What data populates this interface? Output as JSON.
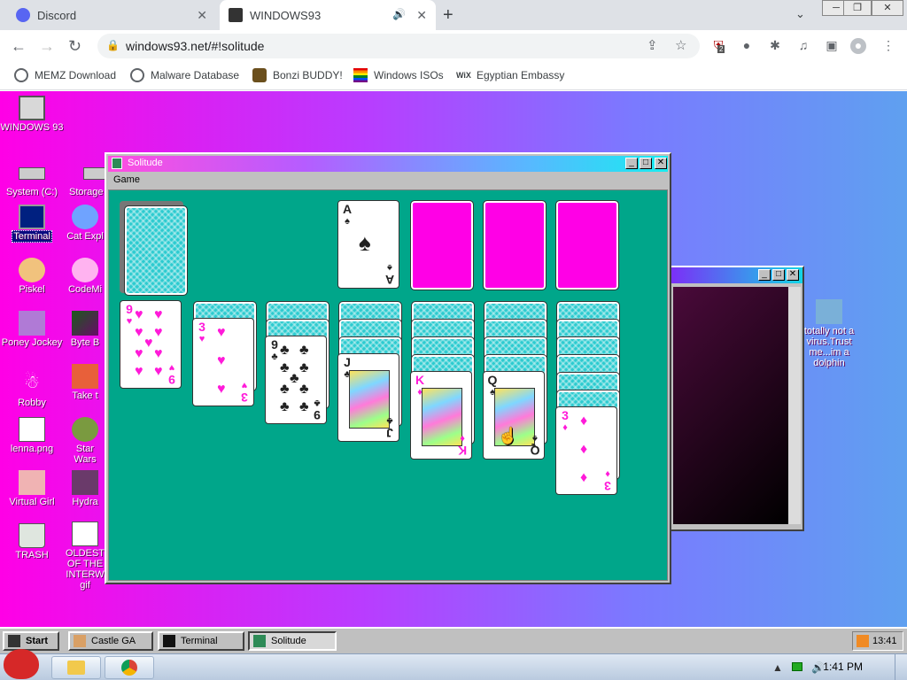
{
  "browser": {
    "tabs": [
      {
        "title": "Discord",
        "active": false
      },
      {
        "title": "WINDOWS93",
        "active": true
      }
    ],
    "url": "windows93.net/#!solitude",
    "window_controls": {
      "minimize": "─",
      "maximize": "❐",
      "close": "✕"
    },
    "bookmarks": [
      {
        "label": "MEMZ Download"
      },
      {
        "label": "Malware Database"
      },
      {
        "label": "Bonzi BUDDY!"
      },
      {
        "label": "Windows ISOs"
      },
      {
        "label": "Egyptian Embassy"
      }
    ],
    "extension_badge": "2"
  },
  "desktop": {
    "icons": [
      {
        "label": "WINDOWS 93"
      },
      {
        "label": "System (C:)"
      },
      {
        "label": "Storage"
      },
      {
        "label": "Terminal"
      },
      {
        "label": "Cat Expl"
      },
      {
        "label": "Piskel"
      },
      {
        "label": "CodeMi"
      },
      {
        "label": "Poney Jockey"
      },
      {
        "label": "Byte B"
      },
      {
        "label": "Robby"
      },
      {
        "label": "Take t"
      },
      {
        "label": "lenna.png"
      },
      {
        "label": "Star Wars"
      },
      {
        "label": "Virtual Girl"
      },
      {
        "label": "Hydra"
      },
      {
        "label": "TRASH"
      },
      {
        "label": "OLDEST OF THE INTERW gif"
      },
      {
        "label": "totally not a virus.Trust me...im a dolphin"
      }
    ]
  },
  "solitude": {
    "title": "Solitude",
    "menu": "Game",
    "cards": {
      "foundation1": {
        "rank": "A",
        "suit": "♠"
      },
      "col1": {
        "rank": "9",
        "suit": "♥"
      },
      "col2": {
        "rank": "3",
        "suit": "♥"
      },
      "col3": {
        "rank": "9",
        "suit": "♣"
      },
      "col4": {
        "rank": "J",
        "suit": "♣"
      },
      "col5": {
        "rank": "K",
        "suit": "♦"
      },
      "col6": {
        "rank": "Q",
        "suit": "♠"
      },
      "col7": {
        "rank": "3",
        "suit": "♦"
      }
    }
  },
  "taskbar93": {
    "start": "Start",
    "items": [
      {
        "label": "Castle GA"
      },
      {
        "label": "Terminal"
      },
      {
        "label": "Solitude"
      }
    ],
    "clock": "13:41"
  },
  "taskbar7": {
    "clock": "1:41 PM"
  },
  "colors": {
    "felt": "#00a68a",
    "card_red": "#ff1ad9",
    "empty_slot": "#ff00e6",
    "card_back": "#2ccbd0"
  }
}
